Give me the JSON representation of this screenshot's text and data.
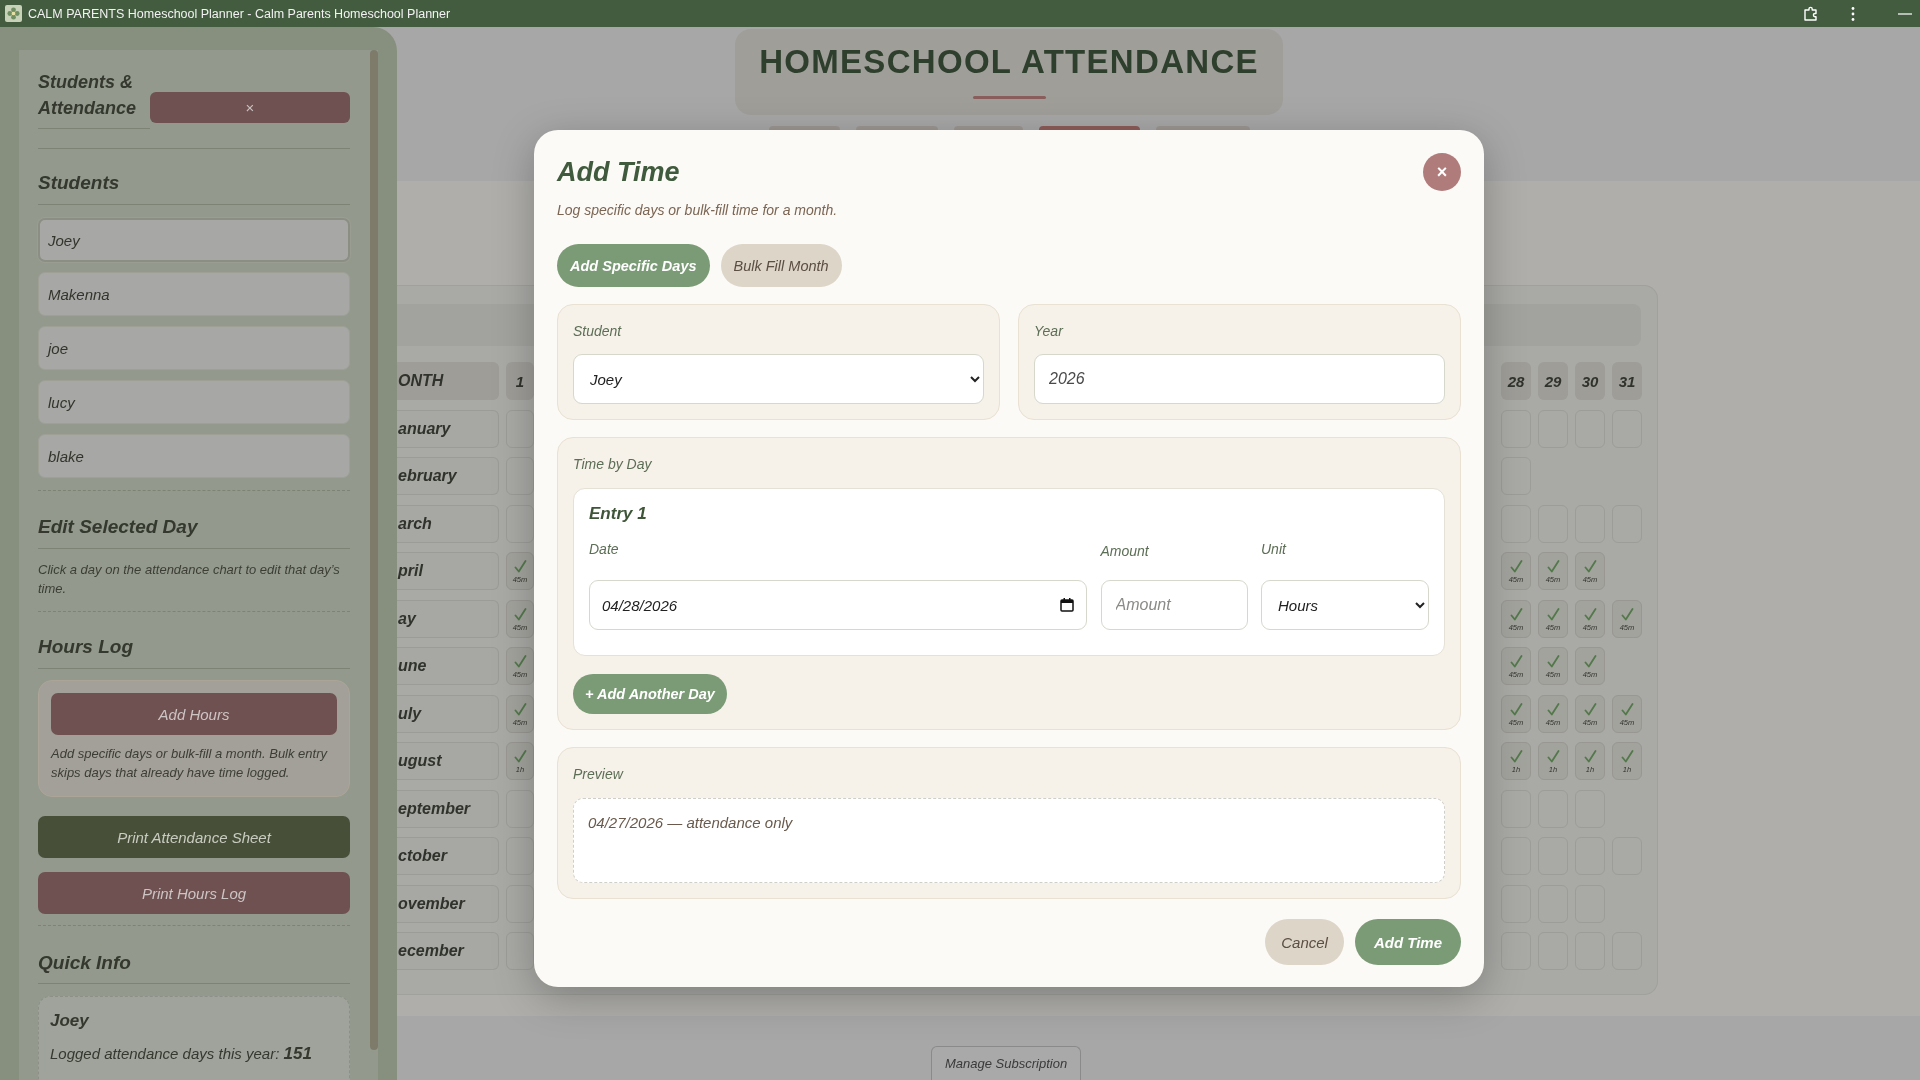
{
  "window": {
    "title": "CALM PARENTS Homeschool Planner - Calm Parents Homeschool Planner"
  },
  "sidebar": {
    "title": "Students & Attendance",
    "close_label": "×",
    "students_heading": "Students",
    "students": [
      {
        "name": "Joey",
        "selected": true
      },
      {
        "name": "Makenna",
        "selected": false
      },
      {
        "name": "joe",
        "selected": false
      },
      {
        "name": "lucy",
        "selected": false
      },
      {
        "name": "blake",
        "selected": false
      }
    ],
    "edit_heading": "Edit Selected Day",
    "edit_hint": "Click a day on the attendance chart to edit that day’s time.",
    "hours_heading": "Hours Log",
    "add_hours_button": "Add Hours",
    "hours_hint": "Add specific days or bulk-fill a month. Bulk entry skips days that already have time logged.",
    "print_buttons": [
      {
        "label": "Print Attendance Sheet",
        "kind": "primary"
      },
      {
        "label": "Print Hours Log",
        "kind": "accent"
      }
    ],
    "quick_info_heading": "Quick Info",
    "quick_info": {
      "student": "Joey",
      "lines": [
        "Logged attendance days this year: **151**"
      ]
    }
  },
  "header": {
    "title": "HOMESCHOOL ATTENDANCE"
  },
  "nav_buttons": [
    {
      "selected": false
    },
    {
      "selected": false
    },
    {
      "selected": false
    },
    {
      "selected": true
    },
    {
      "selected": false
    }
  ],
  "calendar": {
    "columns": [
      "ONTH",
      "1",
      "28",
      "29",
      "30",
      "31"
    ],
    "rows": [
      {
        "month": "anuary",
        "days": [
          {
            "kind": "empty"
          },
          {
            "kind": "empty"
          },
          {
            "kind": "empty"
          },
          {
            "kind": "empty"
          },
          {
            "kind": "empty"
          }
        ]
      },
      {
        "month": "ebruary",
        "days": [
          {
            "kind": "empty"
          },
          {
            "kind": "empty"
          },
          {
            "kind": "none"
          },
          {
            "kind": "none"
          },
          {
            "kind": "none"
          }
        ]
      },
      {
        "month": "arch",
        "days": [
          {
            "kind": "empty"
          },
          {
            "kind": "empty"
          },
          {
            "kind": "empty"
          },
          {
            "kind": "empty"
          },
          {
            "kind": "empty"
          }
        ]
      },
      {
        "month": "pril",
        "days": [
          {
            "kind": "logged",
            "amount": "45m"
          },
          {
            "kind": "logged",
            "amount": "45m"
          },
          {
            "kind": "logged",
            "amount": "45m"
          },
          {
            "kind": "logged",
            "amount": "45m"
          },
          {
            "kind": "none"
          }
        ]
      },
      {
        "month": "ay",
        "days": [
          {
            "kind": "logged",
            "amount": "45m"
          },
          {
            "kind": "logged",
            "amount": "45m"
          },
          {
            "kind": "logged",
            "amount": "45m"
          },
          {
            "kind": "logged",
            "amount": "45m"
          },
          {
            "kind": "logged",
            "amount": "45m"
          }
        ]
      },
      {
        "month": "une",
        "days": [
          {
            "kind": "logged",
            "amount": "45m"
          },
          {
            "kind": "logged",
            "amount": "45m"
          },
          {
            "kind": "logged",
            "amount": "45m"
          },
          {
            "kind": "logged",
            "amount": "45m"
          },
          {
            "kind": "none"
          }
        ]
      },
      {
        "month": "uly",
        "days": [
          {
            "kind": "logged",
            "amount": "45m"
          },
          {
            "kind": "logged",
            "amount": "45m"
          },
          {
            "kind": "logged",
            "amount": "45m"
          },
          {
            "kind": "logged",
            "amount": "45m"
          },
          {
            "kind": "logged",
            "amount": "45m"
          }
        ]
      },
      {
        "month": "ugust",
        "days": [
          {
            "kind": "logged",
            "amount": "1h"
          },
          {
            "kind": "logged",
            "amount": "1h"
          },
          {
            "kind": "logged",
            "amount": "1h"
          },
          {
            "kind": "logged",
            "amount": "1h"
          },
          {
            "kind": "logged",
            "amount": "1h"
          }
        ]
      },
      {
        "month": "eptember",
        "days": [
          {
            "kind": "empty"
          },
          {
            "kind": "empty"
          },
          {
            "kind": "empty"
          },
          {
            "kind": "empty"
          },
          {
            "kind": "none"
          }
        ]
      },
      {
        "month": "ctober",
        "days": [
          {
            "kind": "empty"
          },
          {
            "kind": "empty"
          },
          {
            "kind": "empty"
          },
          {
            "kind": "empty"
          },
          {
            "kind": "empty"
          }
        ]
      },
      {
        "month": "ovember",
        "days": [
          {
            "kind": "empty"
          },
          {
            "kind": "empty"
          },
          {
            "kind": "empty"
          },
          {
            "kind": "empty"
          },
          {
            "kind": "none"
          }
        ]
      },
      {
        "month": "ecember",
        "days": [
          {
            "kind": "empty"
          },
          {
            "kind": "empty"
          },
          {
            "kind": "empty"
          },
          {
            "kind": "empty"
          },
          {
            "kind": "empty"
          }
        ]
      }
    ]
  },
  "modal": {
    "title": "Add Time",
    "close_label": "×",
    "subtitle": "Log specific days or bulk-fill time for a month.",
    "modes": [
      {
        "label": "Add Specific Days",
        "selected": true
      },
      {
        "label": "Bulk Fill Month",
        "selected": false
      }
    ],
    "student_field": {
      "label": "Student",
      "value": "Joey"
    },
    "year_field": {
      "label": "Year",
      "value": "2026"
    },
    "time_by_day": {
      "label": "Time by Day",
      "entries": [
        {
          "title": "Entry 1",
          "date_label": "Date",
          "date_value": "04/28/2026",
          "amount_label": "Amount",
          "amount_placeholder": "Amount",
          "unit_label": "Unit",
          "unit_value": "Hours"
        }
      ],
      "add_button": "+ Add Another Day"
    },
    "preview": {
      "label": "Preview",
      "lines": [
        "04/27/2026 — attendance only"
      ]
    },
    "buttons": [
      {
        "label": "Cancel",
        "kind": "secondary"
      },
      {
        "label": "Add Time",
        "kind": "primary"
      }
    ]
  },
  "footer": {
    "manage_button": "Manage Subscription"
  }
}
